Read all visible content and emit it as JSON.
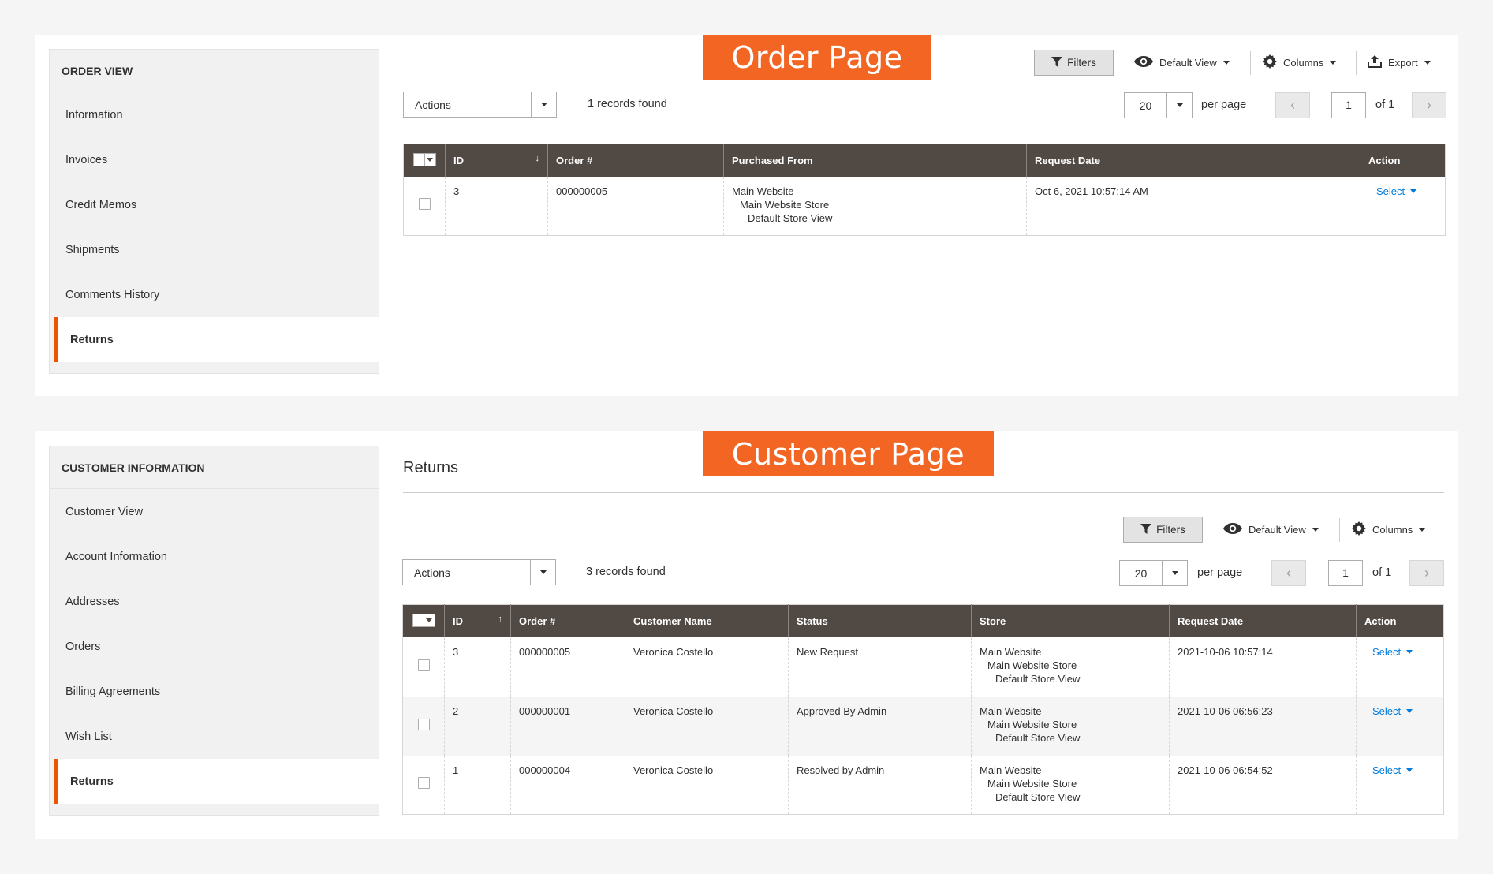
{
  "colors": {
    "accent": "#eb5202",
    "banner": "#f26522",
    "grid_header": "#514943",
    "link": "#007bdb"
  },
  "order_panel": {
    "banner": "Order Page",
    "sidebar": {
      "title": "ORDER VIEW",
      "items": [
        {
          "label": "Information"
        },
        {
          "label": "Invoices"
        },
        {
          "label": "Credit Memos"
        },
        {
          "label": "Shipments"
        },
        {
          "label": "Comments History"
        },
        {
          "label": "Returns",
          "active": true
        }
      ]
    },
    "toolbar": {
      "filters": "Filters",
      "view": "Default View",
      "columns": "Columns",
      "export": "Export",
      "filters_icon": "filter-icon",
      "view_icon": "eye-icon",
      "columns_icon": "gear-icon",
      "export_icon": "export-icon"
    },
    "actions": "Actions",
    "records": "1 records found",
    "per_page_value": "20",
    "per_page_label": "per page",
    "page": "1",
    "of": "of 1",
    "columns": [
      "ID",
      "Order #",
      "Purchased From",
      "Request Date",
      "Action"
    ],
    "rows": [
      {
        "id": "3",
        "order": "000000005",
        "store1": "Main Website",
        "store2": "Main Website Store",
        "store3": "Default Store View",
        "date": "Oct 6, 2021 10:57:14 AM",
        "action": "Select"
      }
    ]
  },
  "customer_panel": {
    "banner": "Customer Page",
    "heading": "Returns",
    "sidebar": {
      "title": "CUSTOMER INFORMATION",
      "items": [
        {
          "label": "Customer View"
        },
        {
          "label": "Account Information"
        },
        {
          "label": "Addresses"
        },
        {
          "label": "Orders"
        },
        {
          "label": "Billing Agreements"
        },
        {
          "label": "Wish List"
        },
        {
          "label": "Returns",
          "active": true
        }
      ]
    },
    "toolbar": {
      "filters": "Filters",
      "view": "Default View",
      "columns": "Columns",
      "filters_icon": "filter-icon",
      "view_icon": "eye-icon",
      "columns_icon": "gear-icon"
    },
    "actions": "Actions",
    "records": "3 records found",
    "per_page_value": "20",
    "per_page_label": "per page",
    "page": "1",
    "of": "of 1",
    "columns": [
      "ID",
      "Order #",
      "Customer Name",
      "Status",
      "Store",
      "Request Date",
      "Action"
    ],
    "rows": [
      {
        "id": "3",
        "order": "000000005",
        "customer": "Veronica Costello",
        "status": "New Request",
        "store1": "Main Website",
        "store2": "Main Website Store",
        "store3": "Default Store View",
        "date": "2021-10-06 10:57:14",
        "action": "Select"
      },
      {
        "id": "2",
        "order": "000000001",
        "customer": "Veronica Costello",
        "status": "Approved By Admin",
        "store1": "Main Website",
        "store2": "Main Website Store",
        "store3": "Default Store View",
        "date": "2021-10-06 06:56:23",
        "action": "Select"
      },
      {
        "id": "1",
        "order": "000000004",
        "customer": "Veronica Costello",
        "status": "Resolved by Admin",
        "store1": "Main Website",
        "store2": "Main Website Store",
        "store3": "Default Store View",
        "date": "2021-10-06 06:54:52",
        "action": "Select"
      }
    ]
  }
}
